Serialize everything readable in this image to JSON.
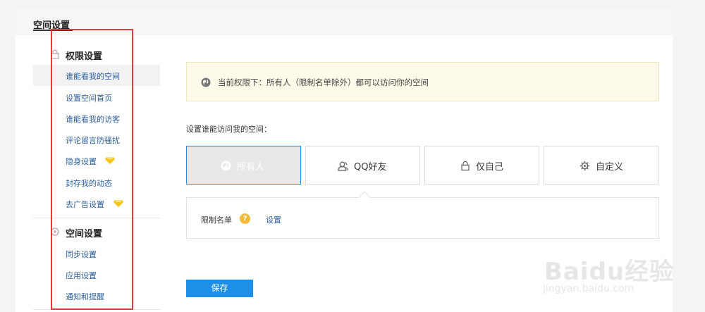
{
  "header": {
    "title": "空间设置"
  },
  "sidebar": {
    "sections": [
      {
        "label": "权限设置",
        "icon": "lock-icon",
        "items": [
          {
            "label": "谁能看我的空间",
            "active": true
          },
          {
            "label": "设置空间首页"
          },
          {
            "label": "谁能看我的访客"
          },
          {
            "label": "评论留言防骚扰"
          },
          {
            "label": "隐身设置",
            "gem": true
          },
          {
            "label": "封存我的动态"
          },
          {
            "label": "去广告设置",
            "gem": true
          }
        ]
      },
      {
        "label": "空间设置",
        "icon": "settings-cycle-icon",
        "items": [
          {
            "label": "同步设置"
          },
          {
            "label": "应用设置"
          },
          {
            "label": "通知和提醒"
          }
        ]
      }
    ]
  },
  "notice": {
    "text": "当前权限下：所有人（限制名单除外）都可以访问你的空间",
    "icon": "globe-icon"
  },
  "access": {
    "label": "设置谁能访问我的空间：",
    "options": [
      {
        "label": "所有人",
        "icon": "globe-icon",
        "selected": true
      },
      {
        "label": "QQ好友",
        "icon": "friends-icon"
      },
      {
        "label": "仅自己",
        "icon": "lock-icon"
      },
      {
        "label": "自定义",
        "icon": "gear-icon"
      }
    ]
  },
  "limit": {
    "label": "限制名单",
    "help": "?",
    "link": "设置"
  },
  "actions": {
    "save": "保存"
  },
  "watermark": {
    "main": "Baidu经验",
    "sub": "jingyan.baidu.com"
  },
  "colors": {
    "accent": "#1e8fe6",
    "link": "#2b5e9c",
    "highlight": "#e63a3a",
    "gem": "#f5c518"
  }
}
